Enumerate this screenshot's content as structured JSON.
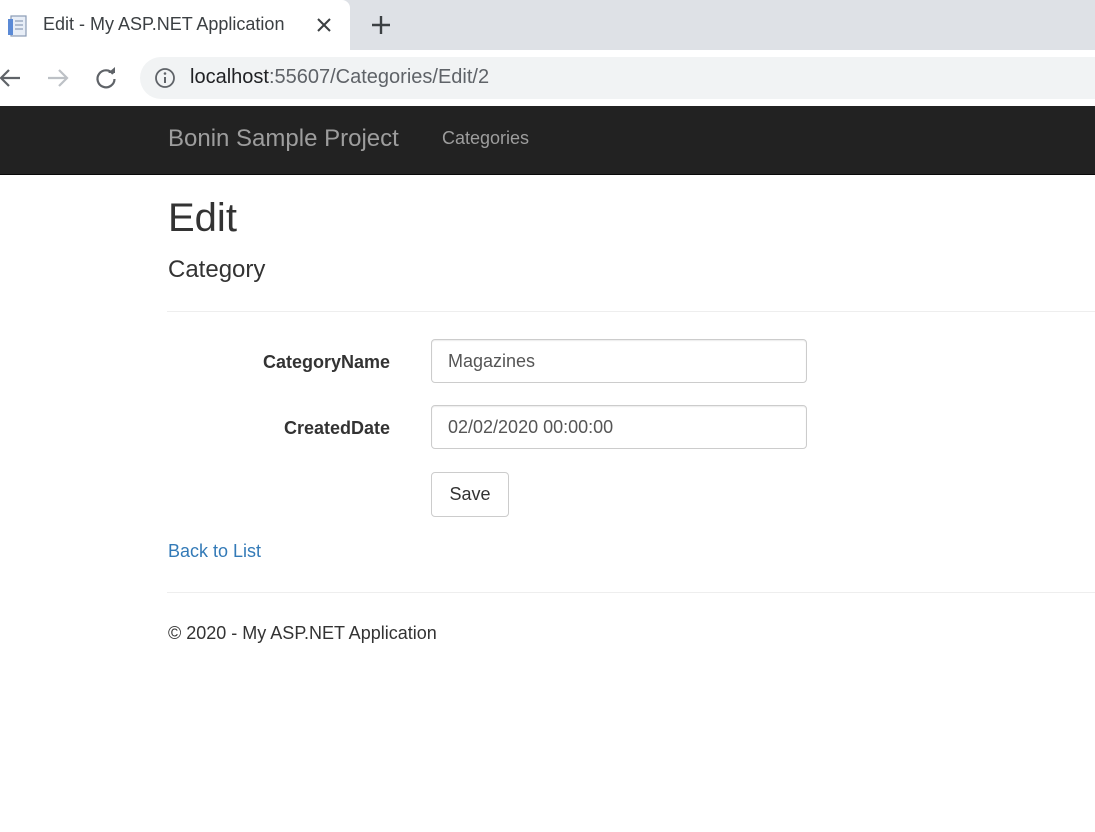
{
  "browser": {
    "tab_title": "Edit - My ASP.NET Application",
    "url_host": "localhost",
    "url_path": ":55607/Categories/Edit/2",
    "icons": {
      "favicon": "page-icon",
      "close": "close-icon",
      "new_tab": "plus-icon",
      "back": "back-arrow-icon",
      "forward": "forward-arrow-icon",
      "reload": "reload-icon",
      "site_info": "info-icon"
    }
  },
  "navbar": {
    "brand": "Bonin Sample Project",
    "links": [
      {
        "label": "Categories"
      }
    ],
    "background": "#222222",
    "link_color": "#9d9d9d"
  },
  "main": {
    "title": "Edit",
    "subtitle": "Category",
    "form": {
      "fields": [
        {
          "label": "CategoryName",
          "value": "Magazines"
        },
        {
          "label": "CreatedDate",
          "value": "02/02/2020 00:00:00"
        }
      ],
      "submit_label": "Save"
    },
    "back_link": "Back to List",
    "link_color": "#337ab7"
  },
  "footer": {
    "text": "© 2020 - My ASP.NET Application"
  }
}
